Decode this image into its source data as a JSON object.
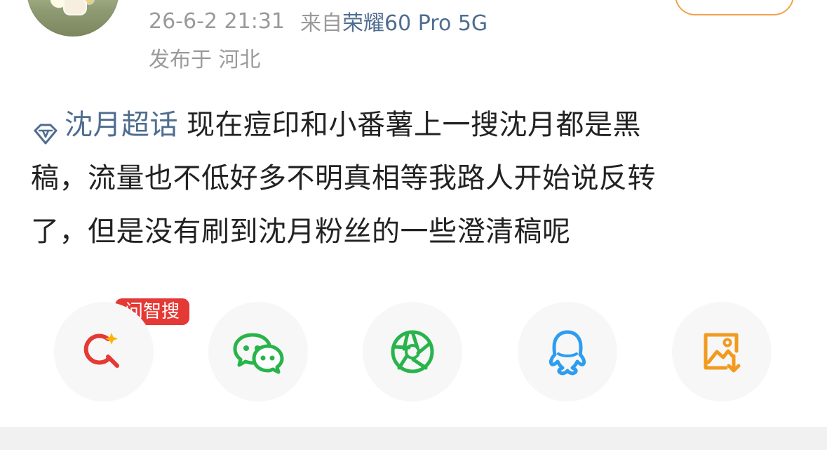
{
  "post": {
    "timestamp": "26-6-2 21:31",
    "device_prefix": "来自",
    "device_name": "荣耀60 Pro 5G",
    "location": "发布于 河北",
    "topic_icon": "diamond-icon",
    "topic_label": "沈月超话",
    "text_lines": [
      "现在痘印和小番薯上一搜沈月都是黑",
      "稿，流量也不低好多不明真相等我路人开始说反转",
      "了，但是没有刷到沈月粉丝的一些澄清稿呢"
    ]
  },
  "actions": {
    "badge_label": "问智搜",
    "items": [
      {
        "icon": "ai-search-icon",
        "color": "#e53935"
      },
      {
        "icon": "wechat-icon",
        "color": "#28b44b"
      },
      {
        "icon": "moments-icon",
        "color": "#28b44b"
      },
      {
        "icon": "qq-icon",
        "color": "#2d9df0"
      },
      {
        "icon": "save-image-icon",
        "color": "#f29a1f"
      }
    ]
  },
  "colors": {
    "link_blue": "#4f6d8f",
    "meta_gray": "#9a9a9a",
    "body_text": "#222222",
    "badge_red": "#e53935",
    "follow_orange": "#f2a24a",
    "action_bg": "#f7f7f7"
  }
}
